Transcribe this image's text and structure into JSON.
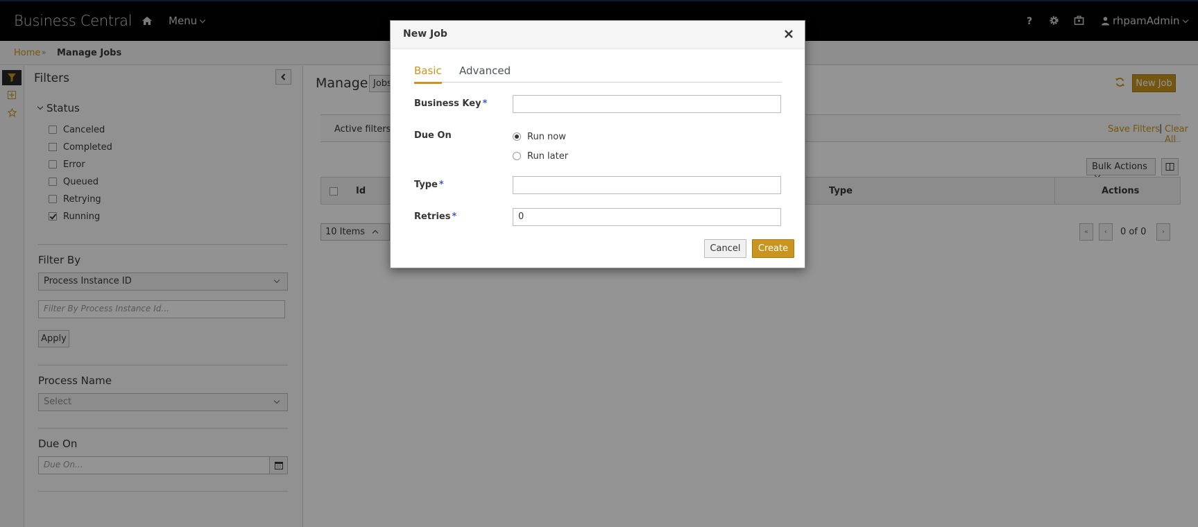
{
  "navbar": {
    "brand": "Business Central",
    "menu_label": "Menu",
    "user_label": "rhpamAdmin",
    "help_label": "?"
  },
  "breadcrumb": {
    "home": "Home",
    "separator": "»",
    "current": "Manage Jobs"
  },
  "filters": {
    "title": "Filters",
    "status_heading": "Status",
    "status_options": [
      {
        "label": "Canceled",
        "checked": false
      },
      {
        "label": "Completed",
        "checked": false
      },
      {
        "label": "Error",
        "checked": false
      },
      {
        "label": "Queued",
        "checked": false
      },
      {
        "label": "Retrying",
        "checked": false
      },
      {
        "label": "Running",
        "checked": true
      }
    ],
    "filter_by_heading": "Filter By",
    "filter_by_value": "Process Instance ID",
    "filter_by_placeholder": "Filter By Process Instance Id...",
    "apply_label": "Apply",
    "process_name_heading": "Process Name",
    "process_name_value": "Select",
    "due_on_heading": "Due On",
    "due_on_placeholder": "Due On..."
  },
  "main": {
    "title": "Manage",
    "jobs_select": "Jobs",
    "new_job_label": "New Job",
    "active_filters_label": "Active filters:",
    "save_filters_label": "Save Filters",
    "pipe": "|",
    "clear_all_label": "Clear All",
    "bulk_actions_label": "Bulk Actions",
    "columns": {
      "id": "Id",
      "type": "Type",
      "actions": "Actions"
    },
    "items_select": "10 Items",
    "pager_text": "0 of 0"
  },
  "modal": {
    "title": "New Job",
    "close_glyph": "×",
    "tabs": [
      {
        "label": "Basic",
        "active": true
      },
      {
        "label": "Advanced",
        "active": false
      }
    ],
    "business_key_label": "Business Key",
    "business_key_value": "",
    "required_mark": "*",
    "due_on_label": "Due On",
    "run_now_label": "Run now",
    "run_later_label": "Run later",
    "due_on_selected": "Run now",
    "type_label": "Type",
    "type_value": "",
    "retries_label": "Retries",
    "retries_value": "0",
    "cancel_label": "Cancel",
    "create_label": "Create"
  },
  "colors": {
    "accent": "#c9951e",
    "navbar_bg": "#030303",
    "required": "#3f57c8"
  },
  "icons": [
    "home-icon",
    "gear-icon",
    "briefcase-icon",
    "user-icon",
    "filter-icon",
    "plus-square-icon",
    "star-icon",
    "chevron-left-icon",
    "refresh-icon",
    "columns-icon",
    "calendar-icon",
    "close-icon"
  ]
}
